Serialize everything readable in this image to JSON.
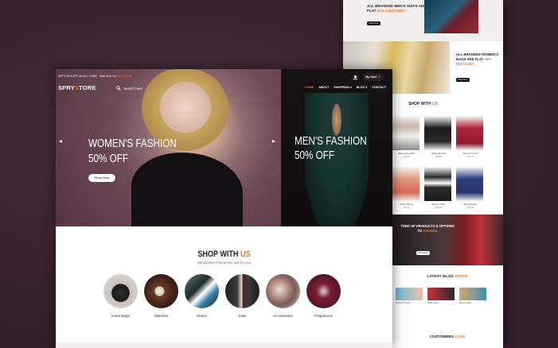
{
  "back_page": {
    "suits_promo": {
      "title": "ALL BRANDED MEN'S SUITS ARE FLAT",
      "highlight": "30% DISCOUNT",
      "button": "Shop Now"
    },
    "bags_promo": {
      "title": "ALL BRANDED WOMEN'S BAGS ARE FLAT",
      "highlight": "30% DISCOUNT",
      "button": "Shop Now"
    },
    "shop_title": "SHOP WITH",
    "shop_title_accent": "US",
    "products": [
      {
        "name": "Men's Pure Shirt",
        "price": "$90.00"
      },
      {
        "name": "Sleek Mini Top",
        "price": "$80.00"
      },
      {
        "name": "Women's Frock",
        "price": "$70.00"
      },
      {
        "name": "Printed Dress",
        "price": "$75.00"
      },
      {
        "name": "Men's T-Shirt",
        "price": "$60.00"
      },
      {
        "name": "Blue Sweater",
        "price": "$85.00"
      }
    ],
    "tons": {
      "line1": "TONS OF PRODUCTS & OPTIONS",
      "line2": "TO",
      "accent": "CHANGE",
      "button": "Shop Now"
    },
    "blog_title": "LATEST BLOG",
    "blog_title_accent": "POSTS",
    "blogs": [
      {
        "title": "Summer Trends"
      },
      {
        "title": "Style Guide"
      },
      {
        "title": "Men's Looks"
      }
    ],
    "customers_title": "CUSTOMERS",
    "customers_accent": "LOVE"
  },
  "front_page": {
    "topbar": {
      "promo": "UPTO 30% OFF ON ALL ITEMS",
      "promo_link_prefix": "Click Here For",
      "promo_link": "More Details"
    },
    "logo": {
      "part1": "SPRY",
      "accent": "S",
      "part2": "TORE"
    },
    "search_placeholder": "Search here",
    "menu": [
      "HOME",
      "ABOUT",
      "SHOPPING ▾",
      "BLOG ▾",
      "CONTACT"
    ],
    "cart_label": "My Cart",
    "hero_left": {
      "line1": "WOMEN'S FASHION",
      "line2": "50% OFF",
      "button": "Shop Now"
    },
    "hero_right": {
      "line1": "MEN'S FASHION",
      "line2": "50% OFF"
    },
    "shop_title": "SHOP WITH",
    "shop_title_accent": "US",
    "shop_sub": "Handpicked Favourites just for you",
    "categories": [
      "Hand Bags",
      "Watches",
      "Shoes",
      "Suits",
      "Accessories",
      "Fragrances"
    ]
  },
  "colors": {
    "accent": "#e8742a",
    "hero_left_bg": "#6d4a56",
    "hero_right_bg": "#121012",
    "backdrop": "#3b2530"
  }
}
